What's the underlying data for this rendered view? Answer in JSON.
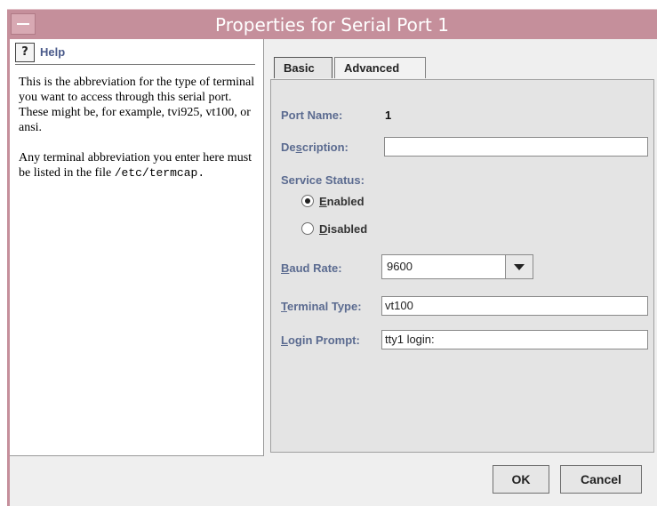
{
  "window": {
    "title": "Properties for Serial Port 1"
  },
  "help": {
    "title": "Help",
    "icon": "help-icon",
    "paragraph1": "This is the abbreviation for the type of terminal you want to access through this serial port. These might be, for example, tvi925, vt100, or ansi.",
    "paragraph2_prefix": "Any terminal abbreviation you enter here must be listed in the file",
    "paragraph2_path": "/etc/termcap."
  },
  "tabs": [
    {
      "label": "Basic",
      "selected": true
    },
    {
      "label": "Advanced",
      "selected": false
    }
  ],
  "form": {
    "port_name_label": "Port Name:",
    "port_name_value": "1",
    "description_label_pre": "De",
    "description_label_u": "s",
    "description_label_post": "cription:",
    "description_value": "",
    "service_status_label": "Service Status:",
    "enabled_u": "E",
    "enabled_rest": "nabled",
    "disabled_u": "D",
    "disabled_rest": "isabled",
    "service_status_value": "Enabled",
    "baud_rate_label_u": "B",
    "baud_rate_label_rest": "aud Rate:",
    "baud_rate_value": "9600",
    "terminal_type_label_u": "T",
    "terminal_type_label_rest": "erminal Type:",
    "terminal_type_value": "vt100",
    "login_prompt_label_u": "L",
    "login_prompt_label_rest": "ogin Prompt:",
    "login_prompt_value": "tty1 login:"
  },
  "buttons": {
    "ok": "OK",
    "cancel": "Cancel"
  },
  "colors": {
    "titlebar": "#c58f9b",
    "label": "#5b6b90"
  }
}
